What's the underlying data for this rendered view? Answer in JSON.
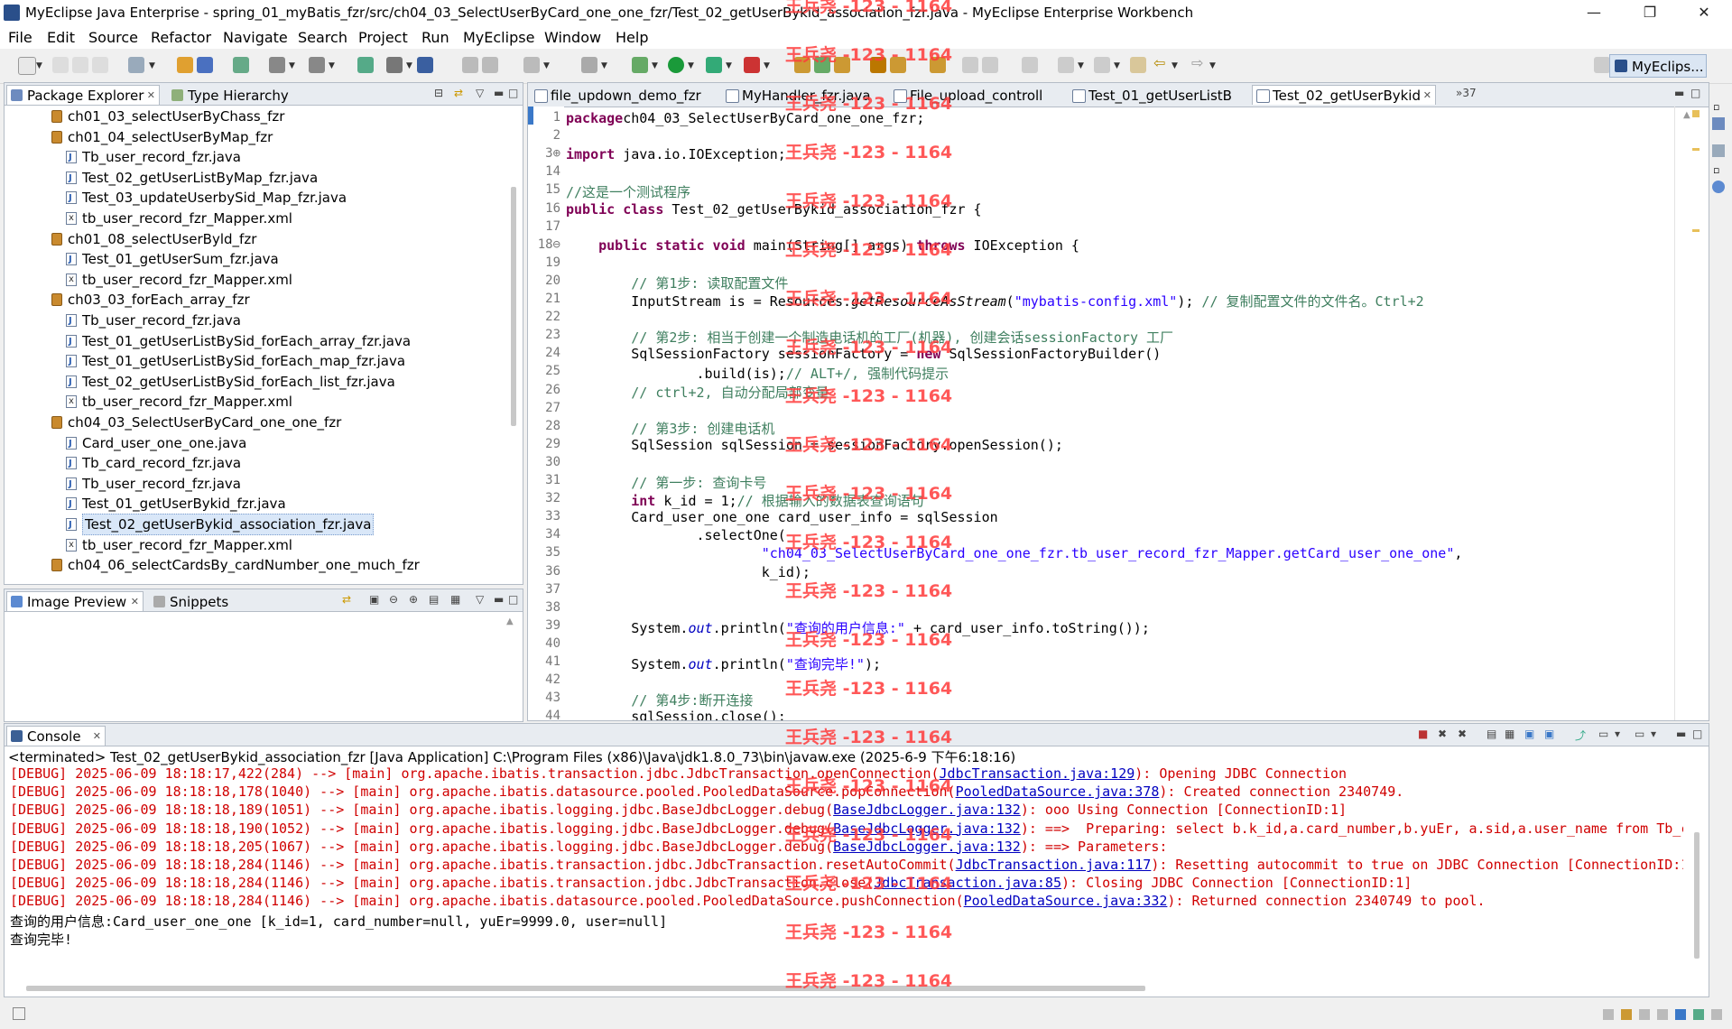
{
  "window": {
    "title": "MyEclipse Java Enterprise - spring_01_myBatis_fzr/src/ch04_03_SelectUserByCard_one_one_fzr/Test_02_getUserBykid_association_fzr.java - MyEclipse Enterprise Workbench",
    "minimize": "—",
    "maximize": "❐",
    "close": "✕"
  },
  "menu": [
    "File",
    "Edit",
    "Source",
    "Refactor",
    "Navigate",
    "Search",
    "Project",
    "Run",
    "MyEclipse",
    "Window",
    "Help"
  ],
  "perspective": "MyEclips...",
  "package_explorer": {
    "tabs": [
      "Package Explorer",
      "Type Hierarchy"
    ],
    "tree": [
      {
        "label": "ch01_03_selectUserByChass_fzr",
        "type": "pkg",
        "level": 0
      },
      {
        "label": "ch01_04_selectUserByMap_fzr",
        "type": "pkg",
        "level": 0
      },
      {
        "label": "Tb_user_record_fzr.java",
        "type": "java",
        "level": 1
      },
      {
        "label": "Test_02_getUserListByMap_fzr.java",
        "type": "java",
        "level": 1
      },
      {
        "label": "Test_03_updateUserbySid_Map_fzr.java",
        "type": "java",
        "level": 1
      },
      {
        "label": "tb_user_record_fzr_Mapper.xml",
        "type": "xml",
        "level": 1
      },
      {
        "label": "ch01_08_selectUserByld_fzr",
        "type": "pkg",
        "level": 0
      },
      {
        "label": "Test_01_getUserSum_fzr.java",
        "type": "java",
        "level": 1
      },
      {
        "label": "tb_user_record_fzr_Mapper.xml",
        "type": "xml",
        "level": 1
      },
      {
        "label": "ch03_03_forEach_array_fzr",
        "type": "pkg",
        "level": 0
      },
      {
        "label": "Tb_user_record_fzr.java",
        "type": "java",
        "level": 1
      },
      {
        "label": "Test_01_getUserListBySid_forEach_array_fzr.java",
        "type": "java",
        "level": 1
      },
      {
        "label": "Test_01_getUserListBySid_forEach_map_fzr.java",
        "type": "java",
        "level": 1
      },
      {
        "label": "Test_02_getUserListBySid_forEach_list_fzr.java",
        "type": "java",
        "level": 1
      },
      {
        "label": "tb_user_record_fzr_Mapper.xml",
        "type": "xml",
        "level": 1
      },
      {
        "label": "ch04_03_SelectUserByCard_one_one_fzr",
        "type": "pkg",
        "level": 0
      },
      {
        "label": "Card_user_one_one.java",
        "type": "java",
        "level": 1
      },
      {
        "label": "Tb_card_record_fzr.java",
        "type": "java",
        "level": 1
      },
      {
        "label": "Tb_user_record_fzr.java",
        "type": "java",
        "level": 1
      },
      {
        "label": "Test_01_getUserBykid_fzr.java",
        "type": "java",
        "level": 1
      },
      {
        "label": "Test_02_getUserBykid_association_fzr.java",
        "type": "java",
        "level": 1,
        "selected": true
      },
      {
        "label": "tb_user_record_fzr_Mapper.xml",
        "type": "xml",
        "level": 1
      },
      {
        "label": "ch04_06_selectCardsBy_cardNumber_one_much_fzr",
        "type": "pkg",
        "level": 0
      }
    ]
  },
  "image_preview": {
    "tabs": [
      "Image Preview",
      "Snippets"
    ]
  },
  "editor": {
    "tabs": [
      "file_updown_demo_fzr",
      "MyHandler_fzr.java",
      "File_upload_controll",
      "Test_01_getUserListB",
      "Test_02_getUserBykid"
    ],
    "overflow": "»37",
    "lines": [
      {
        "n": "1",
        "segs": [
          [
            "kw",
            "package"
          ],
          [
            "",
            "ch04_03_SelectUserByCard_one_one_fzr;"
          ]
        ]
      },
      {
        "n": "2",
        "segs": []
      },
      {
        "n": "3⊕",
        "segs": [
          [
            "kw",
            "import"
          ],
          [
            "",
            " java.io.IOException;"
          ]
        ]
      },
      {
        "n": "14",
        "segs": []
      },
      {
        "n": "15",
        "segs": [
          [
            "cm",
            "//这是一个测试程序"
          ]
        ]
      },
      {
        "n": "16",
        "segs": [
          [
            "kw",
            "public class"
          ],
          [
            "",
            " Test_02_getUserBykid_association_fzr {"
          ]
        ]
      },
      {
        "n": "17",
        "segs": []
      },
      {
        "n": "18⊖",
        "segs": [
          [
            "",
            "    "
          ],
          [
            "kw",
            "public static void"
          ],
          [
            "",
            " main(String[] args) "
          ],
          [
            "kw",
            "throws"
          ],
          [
            "",
            " IOException {"
          ]
        ]
      },
      {
        "n": "19",
        "segs": []
      },
      {
        "n": "20",
        "segs": [
          [
            "",
            "        "
          ],
          [
            "cm",
            "// 第1步: 读取配置文件"
          ]
        ]
      },
      {
        "n": "21",
        "segs": [
          [
            "",
            "        InputStream is = Resources."
          ],
          [
            "it",
            "getResourceAsStream"
          ],
          [
            "",
            "("
          ],
          [
            "st",
            "\"mybatis-config.xml\""
          ],
          [
            "",
            "); "
          ],
          [
            "cm",
            "// 复制配置文件的文件名。Ctrl+2"
          ]
        ]
      },
      {
        "n": "22",
        "segs": []
      },
      {
        "n": "23",
        "segs": [
          [
            "",
            "        "
          ],
          [
            "cm",
            "// 第2步: 相当于创建一个制造电话机的工厂(机器), 创建会话sessionFactory 工厂"
          ]
        ]
      },
      {
        "n": "24",
        "segs": [
          [
            "",
            "        SqlSessionFactory sessionFactory = "
          ],
          [
            "kw",
            "new"
          ],
          [
            "",
            " SqlSessionFactoryBuilder()"
          ]
        ]
      },
      {
        "n": "25",
        "segs": [
          [
            "",
            "                .build(is);"
          ],
          [
            "cm",
            "// ALT+/, 强制代码提示"
          ]
        ]
      },
      {
        "n": "26",
        "segs": [
          [
            "",
            "        "
          ],
          [
            "cm",
            "// ctrl+2, 自动分配局部变量"
          ]
        ]
      },
      {
        "n": "27",
        "segs": []
      },
      {
        "n": "28",
        "segs": [
          [
            "",
            "        "
          ],
          [
            "cm",
            "// 第3步: 创建电话机"
          ]
        ]
      },
      {
        "n": "29",
        "segs": [
          [
            "",
            "        SqlSession sqlSession = sessionFactory.openSession();"
          ]
        ]
      },
      {
        "n": "30",
        "segs": []
      },
      {
        "n": "31",
        "segs": [
          [
            "",
            "        "
          ],
          [
            "cm",
            "// 第一步: 查询卡号"
          ]
        ]
      },
      {
        "n": "32",
        "segs": [
          [
            "",
            "        "
          ],
          [
            "kw",
            "int"
          ],
          [
            "",
            " k_id = 1;"
          ],
          [
            "cm",
            "// 根据输入的数据表查询语句"
          ]
        ]
      },
      {
        "n": "33",
        "segs": [
          [
            "",
            "        Card_user_one_one card_user_info = sqlSession"
          ]
        ]
      },
      {
        "n": "34",
        "segs": [
          [
            "",
            "                .selectOne("
          ]
        ]
      },
      {
        "n": "35",
        "segs": [
          [
            "",
            "                        "
          ],
          [
            "st",
            "\"ch04_03_SelectUserByCard_one_one_fzr.tb_user_record_fzr_Mapper.getCard_user_one_one\""
          ],
          [
            "",
            ","
          ]
        ]
      },
      {
        "n": "36",
        "segs": [
          [
            "",
            "                        k_id);"
          ]
        ]
      },
      {
        "n": "37",
        "segs": []
      },
      {
        "n": "38",
        "segs": []
      },
      {
        "n": "39",
        "segs": [
          [
            "",
            "        System."
          ],
          [
            "fd",
            "out"
          ],
          [
            "",
            ".println("
          ],
          [
            "st",
            "\"查询的用户信息:\""
          ],
          [
            "",
            " + card_user_info.toString());"
          ]
        ]
      },
      {
        "n": "40",
        "segs": []
      },
      {
        "n": "41",
        "segs": [
          [
            "",
            "        System."
          ],
          [
            "fd",
            "out"
          ],
          [
            "",
            ".println("
          ],
          [
            "st",
            "\"查询完毕!\""
          ],
          [
            "",
            ");"
          ]
        ]
      },
      {
        "n": "42",
        "segs": []
      },
      {
        "n": "43",
        "segs": [
          [
            "",
            "        "
          ],
          [
            "cm",
            "// 第4步:断开连接"
          ]
        ]
      },
      {
        "n": "44",
        "segs": [
          [
            "",
            "        sqlSession.close();"
          ]
        ]
      }
    ]
  },
  "console": {
    "tab": "Console",
    "header": "<terminated> Test_02_getUserBykid_association_fzr [Java Application] C:\\Program Files (x86)\\Java\\jdk1.8.0_73\\bin\\javaw.exe (2025-6-9 下午6:18:16)",
    "lines": [
      {
        "kind": "dbg",
        "pre": "[DEBUG] 2025-06-09 18:18:17,422(284) --> [main] org.apache.ibatis.transaction.jdbc.JdbcTransaction.openConnection(",
        "link": "JdbcTransaction.java:129",
        "post": "): Opening JDBC Connection"
      },
      {
        "kind": "dbg",
        "pre": "[DEBUG] 2025-06-09 18:18:18,178(1040) --> [main] org.apache.ibatis.datasource.pooled.PooledDataSource.popConnection(",
        "link": "PooledDataSource.java:378",
        "post": "): Created connection 2340749."
      },
      {
        "kind": "dbg",
        "pre": "[DEBUG] 2025-06-09 18:18:18,189(1051) --> [main] org.apache.ibatis.logging.jdbc.BaseJdbcLogger.debug(",
        "link": "BaseJdbcLogger.java:132",
        "post": "): ooo Using Connection [ConnectionID:1]"
      },
      {
        "kind": "dbg",
        "pre": "[DEBUG] 2025-06-09 18:18:18,190(1052) --> [main] org.apache.ibatis.logging.jdbc.BaseJdbcLogger.debug(",
        "link": "BaseJdbcLogger.java:132",
        "post": "): ==>  Preparing: select b.k_id,a.card_number,b.yuEr, a.sid,a.user_name from Tb_ca"
      },
      {
        "kind": "dbg",
        "pre": "[DEBUG] 2025-06-09 18:18:18,205(1067) --> [main] org.apache.ibatis.logging.jdbc.BaseJdbcLogger.debug(",
        "link": "BaseJdbcLogger.java:132",
        "post": "): ==> Parameters: "
      },
      {
        "kind": "dbg",
        "pre": "[DEBUG] 2025-06-09 18:18:18,284(1146) --> [main] org.apache.ibatis.transaction.jdbc.JdbcTransaction.resetAutoCommit(",
        "link": "JdbcTransaction.java:117",
        "post": "): Resetting autocommit to true on JDBC Connection [ConnectionID:1"
      },
      {
        "kind": "dbg",
        "pre": "[DEBUG] 2025-06-09 18:18:18,284(1146) --> [main] org.apache.ibatis.transaction.jdbc.JdbcTransaction.close(",
        "link": "JdbcTransaction.java:85",
        "post": "): Closing JDBC Connection [ConnectionID:1]"
      },
      {
        "kind": "dbg",
        "pre": "[DEBUG] 2025-06-09 18:18:18,284(1146) --> [main] org.apache.ibatis.datasource.pooled.PooledDataSource.pushConnection(",
        "link": "PooledDataSource.java:332",
        "post": "): Returned connection 2340749 to pool."
      },
      {
        "kind": "out",
        "pre": "查询的用户信息:Card_user_one_one [k_id=1, card_number=null, yuEr=9999.0, user=null]",
        "link": "",
        "post": ""
      },
      {
        "kind": "out",
        "pre": "查询完毕!",
        "link": "",
        "post": ""
      }
    ]
  },
  "watermark": "王兵尧 -123 - 1164",
  "colors": {
    "keyword": "#7f0055",
    "comment": "#3f7f5f",
    "string": "#2a00ff",
    "debug": "#d00000",
    "watermark": "#ff3b3b"
  }
}
